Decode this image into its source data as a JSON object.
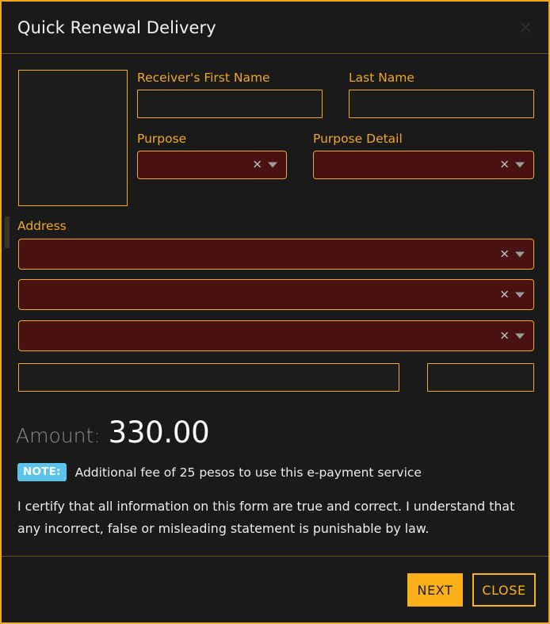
{
  "window": {
    "title": "Quick Renewal Delivery",
    "close_icon": "close-icon",
    "accent_color": "#f0a81c",
    "background_color": "#1a1a1a",
    "dropdown_fill_color": "#4a1111"
  },
  "form": {
    "photo_placeholder": "",
    "fields": {
      "first_name": {
        "label": "Receiver's First Name",
        "value": ""
      },
      "last_name": {
        "label": "Last Name",
        "value": ""
      },
      "purpose": {
        "label": "Purpose",
        "value": "",
        "clear_icon": "x-clear-icon",
        "caret_icon": "chevron-down-icon"
      },
      "purpose_detail": {
        "label": "Purpose Detail",
        "value": "",
        "clear_icon": "x-clear-icon",
        "caret_icon": "chevron-down-icon"
      },
      "address": {
        "label": "Address"
      },
      "address_line_1": {
        "value": "",
        "clear_icon": "x-clear-icon",
        "caret_icon": "chevron-down-icon"
      },
      "address_line_2": {
        "value": "",
        "clear_icon": "x-clear-icon",
        "caret_icon": "chevron-down-icon"
      },
      "address_line_3": {
        "value": "",
        "clear_icon": "x-clear-icon",
        "caret_icon": "chevron-down-icon"
      },
      "street": {
        "value": ""
      },
      "zip": {
        "value": ""
      }
    }
  },
  "amount": {
    "label": "Amount:",
    "value": "330.00"
  },
  "note": {
    "badge": "NOTE:",
    "text": "Additional fee of 25 pesos to use this e-payment service",
    "badge_color": "#5bc4ea"
  },
  "certification": {
    "text": "I certify that all information on this form are true and correct. I understand that any incorrect, false or misleading statement is punishable by law."
  },
  "footer": {
    "next_label": "NEXT",
    "close_label": "CLOSE"
  }
}
